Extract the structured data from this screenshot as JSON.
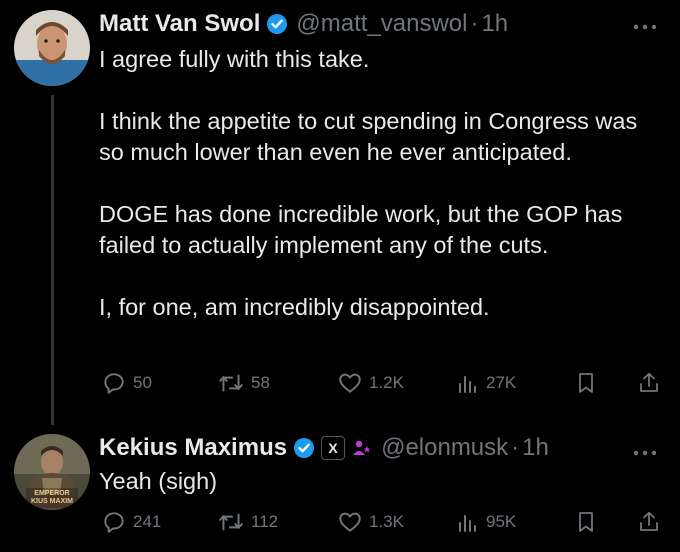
{
  "tweet1": {
    "name": "Matt Van Swol",
    "handle": "@matt_vanswol",
    "separator": "·",
    "time": "1h",
    "text": "I agree fully with this take.\n\nI think the appetite to cut spending in Congress was so much lower than even he ever anticipated.\n\nDOGE has done incredible work, but the GOP has failed to actually implement any of the cuts.\n\nI, for one, am incredibly disappointed.",
    "replies": "50",
    "reposts": "58",
    "likes": "1.2K",
    "views": "27K"
  },
  "tweet2": {
    "name": "Kekius Maximus",
    "handle": "@elonmusk",
    "separator": "·",
    "time": "1h",
    "text": "Yeah (sigh)",
    "avatar_caption_line1": "EMPEROR",
    "avatar_caption_line2": "KIUS MAXIM",
    "affiliate_badge": "X",
    "replies": "241",
    "reposts": "112",
    "likes": "1.3K",
    "views": "95K"
  },
  "colors": {
    "verified": "#1d9bf0",
    "muted": "#71767b",
    "text": "#e7e9ea",
    "affiliate": "#c13ad6"
  },
  "icons": [
    "reply-icon",
    "repost-icon",
    "like-icon",
    "views-icon",
    "bookmark-icon",
    "share-icon",
    "more-icon",
    "verified-badge-icon"
  ]
}
